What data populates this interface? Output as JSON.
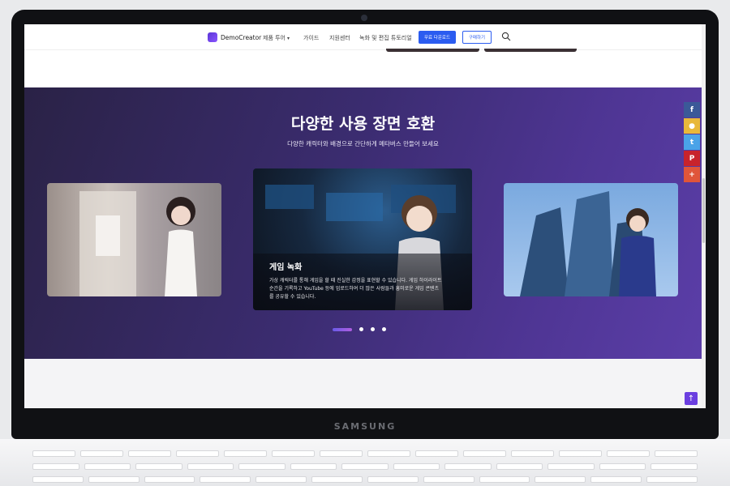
{
  "device": {
    "brand": "SAMSUNG"
  },
  "nav": {
    "logo_text": "DemoCreator",
    "items": [
      "제품 투어",
      "가이드",
      "지원센터",
      "녹화 및 편집 튜토리얼"
    ],
    "download_label": "무료 다운로드",
    "buy_label": "구매하기",
    "search_icon": "search-icon"
  },
  "hero": {
    "title": "다양한 사용 장면 호환",
    "subtitle": "다양한 캐릭터와 배경으로 간단하게 메타버스 만들어 보세요",
    "card_center": {
      "title": "게임 녹화",
      "body_lines": [
        "가상 캐릭터를 통해 게임을 할 때 진실한 감정을 표현할 수 있습니다. 게임 하이라이트",
        "순간을 기록하고 YouTube 등에 업로드하여 더 많은 사람들과 흥미로운 게임 콘텐츠",
        "를 공유할 수 있습니다."
      ]
    },
    "carousel_active_index": 0,
    "carousel_count": 4
  },
  "social": [
    {
      "name": "facebook-icon",
      "glyph": "f",
      "color": "#3b5998"
    },
    {
      "name": "kakao-icon",
      "glyph": "●",
      "color": "#e8b83a"
    },
    {
      "name": "twitter-icon",
      "glyph": "t",
      "color": "#4aa3e8"
    },
    {
      "name": "pinterest-icon",
      "glyph": "P",
      "color": "#c8232c"
    },
    {
      "name": "plus-icon",
      "glyph": "+",
      "color": "#e0553a"
    }
  ],
  "colors": {
    "accent": "#2b5cf0",
    "hero_purple": "#4e3593",
    "to_top": "#6b3fe0"
  }
}
